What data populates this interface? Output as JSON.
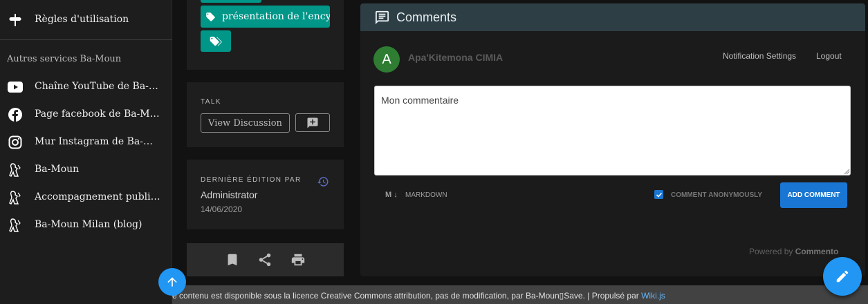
{
  "sidebar": {
    "top_item": {
      "label": "Règles d'utilisation",
      "icon": "signpost-icon"
    },
    "subheader": "Autres services Ba-Moun",
    "items": [
      {
        "label": "Chaîne YouTube de Ba-Moun",
        "icon": "youtube-icon"
      },
      {
        "label": "Page facebook de Ba-Moun",
        "icon": "facebook-icon"
      },
      {
        "label": "Mur Instagram de Ba-Moun",
        "icon": "instagram-icon"
      },
      {
        "label": "Ba-Moun",
        "icon": "ba-moun-logo-icon"
      },
      {
        "label": "Accompagnement publicitaire",
        "icon": "ba-moun-logo-icon"
      },
      {
        "label": "Ba-Moun Milan (blog)",
        "icon": "ba-moun-logo-icon"
      }
    ]
  },
  "tags": {
    "chip_label": "présentation de l'ency"
  },
  "talk": {
    "label": "TALK",
    "view_discussion": "View Discussion"
  },
  "last_edit": {
    "label": "DERNIÈRE ÉDITION PAR",
    "author": "Administrator",
    "date": "14/06/2020"
  },
  "comments": {
    "title": "Comments",
    "user_initial": "A",
    "user_name": "Apa'Kitemona CIMIA",
    "notification_settings": "Notification Settings",
    "logout": "Logout",
    "textarea_value": "Mon commentaire",
    "markdown_icon": "M ↓",
    "markdown_label": "MARKDOWN",
    "anonymous_label": "COMMENT ANONYMOUSLY",
    "anonymous_checked": true,
    "add_comment": "ADD COMMENT",
    "powered_by": "Powered by",
    "powered_brand": "Commento"
  },
  "footer": {
    "text": "e contenu est disponible sous la licence Creative Commons attribution, pas de modification, par Ba-Moun▯Save. | Propulsé par ",
    "link": "Wiki.js"
  },
  "colors": {
    "accent_teal": "#009688",
    "accent_blue": "#1976d2",
    "fab_blue": "#2196f3",
    "header_bg": "#2d3e45",
    "avatar_green": "#2e7d32"
  }
}
